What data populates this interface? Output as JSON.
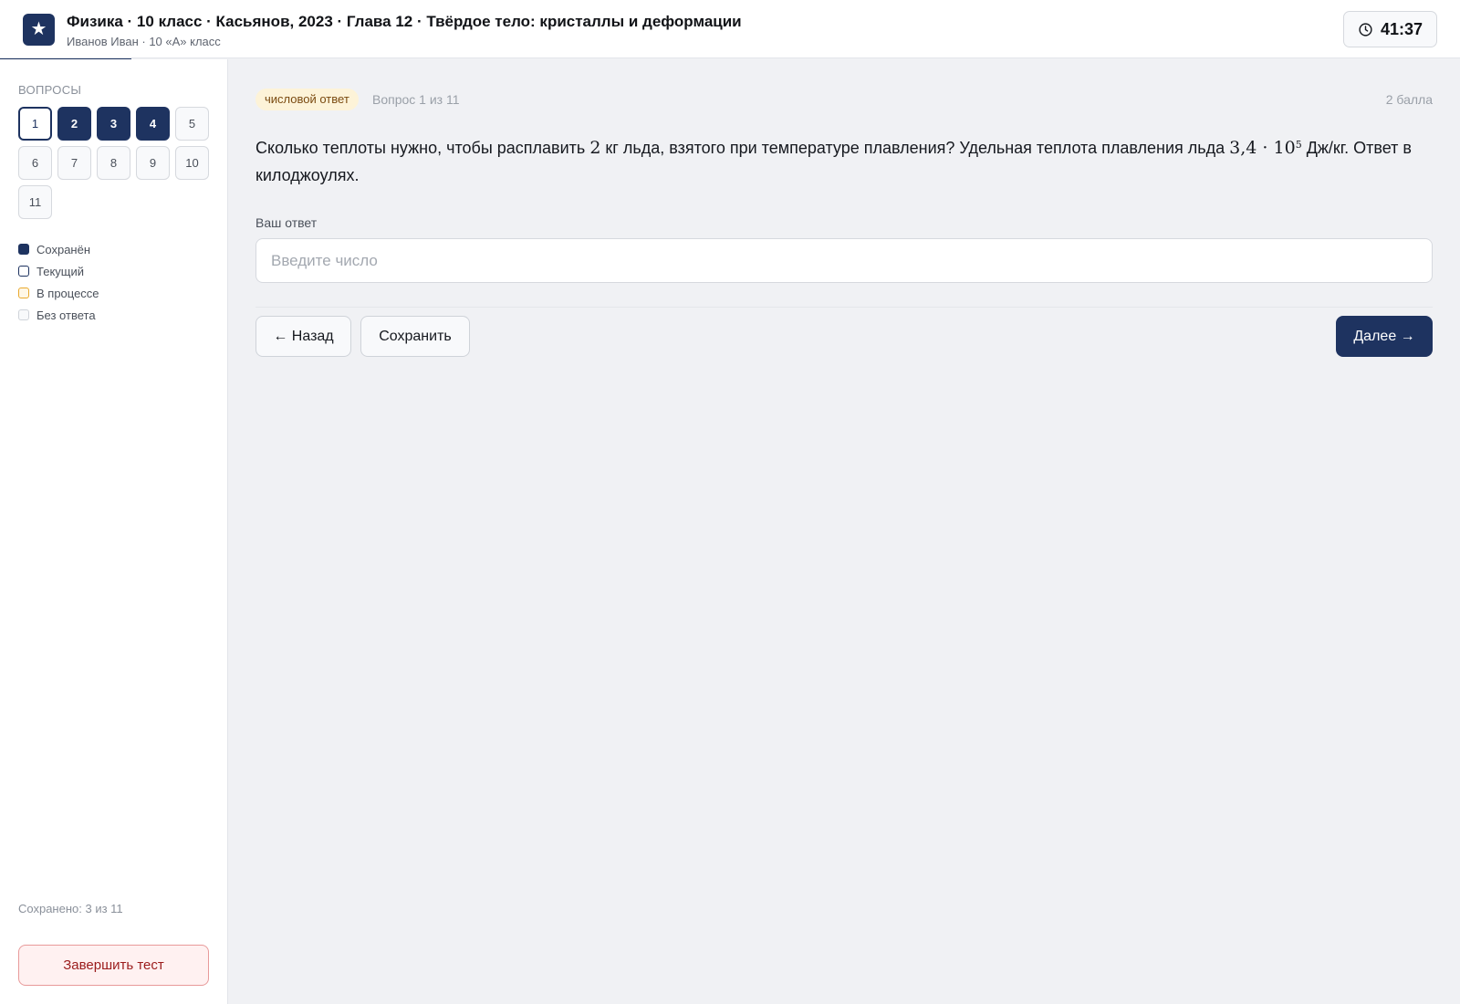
{
  "header": {
    "logo_icon": "star-icon",
    "logo_glyph": "★",
    "title": "Физика · 10 класс · Касьянов, 2023 · Глава 12 · Твёрдое тело: кристаллы и деформации",
    "subtitle": "Иванов Иван · 10 «А» класс",
    "timer_icon": "clock-icon",
    "timer": "41:37"
  },
  "progress_fraction": 0.09,
  "sidebar": {
    "heading": "ВОПРОСЫ",
    "questions": [
      {
        "label": "1",
        "state": "current"
      },
      {
        "label": "2",
        "state": "saved"
      },
      {
        "label": "3",
        "state": "saved"
      },
      {
        "label": "4",
        "state": "saved"
      },
      {
        "label": "5",
        "state": "empty"
      },
      {
        "label": "6",
        "state": "empty"
      },
      {
        "label": "7",
        "state": "empty"
      },
      {
        "label": "8",
        "state": "empty"
      },
      {
        "label": "9",
        "state": "empty"
      },
      {
        "label": "10",
        "state": "empty"
      },
      {
        "label": "11",
        "state": "empty"
      }
    ],
    "legend": [
      {
        "label": "Сохранён",
        "kind": "saved"
      },
      {
        "label": "Текущий",
        "kind": "current"
      },
      {
        "label": "В процессе",
        "kind": "progress"
      },
      {
        "label": "Без ответа",
        "kind": "empty"
      }
    ],
    "saved_count": "Сохранено: 3 из 11",
    "finish_label": "Завершить тест"
  },
  "question": {
    "type_badge": "числовой ответ",
    "meta": "Вопрос 1 из 11",
    "points": "2 балла",
    "text_before": "Сколько теплоты нужно, чтобы расплавить ",
    "math_mass": "2",
    "text_middle": " кг льда, взятого при температуре плавления? Удельная теплота плавления льда ",
    "math_heat_base": "3,4 · 10",
    "math_heat_exp": "5",
    "text_after": " Дж/кг. Ответ в килоджоулях.",
    "answer_label": "Ваш ответ",
    "answer_value": "",
    "answer_placeholder": "Введите число"
  },
  "nav": {
    "back_label": "← Назад",
    "save_label": "Сохранить",
    "next_label": "Далее →"
  },
  "colors": {
    "accent": "#1e3360",
    "in_progress": "#e9a92d",
    "danger": "#9b1c1c"
  }
}
